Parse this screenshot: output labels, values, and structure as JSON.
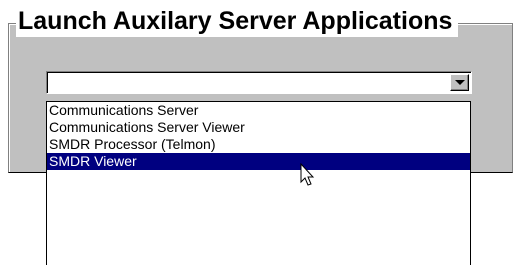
{
  "group": {
    "title": "Launch Auxilary Server Applications"
  },
  "combo": {
    "value": "",
    "button_icon": "dropdown-arrow-icon"
  },
  "dropdown": {
    "items": [
      {
        "label": "Communications Server",
        "selected": false
      },
      {
        "label": "Communications Server Viewer",
        "selected": false
      },
      {
        "label": "SMDR Processor (Telmon)",
        "selected": false
      },
      {
        "label": "SMDR Viewer",
        "selected": true
      }
    ]
  },
  "colors": {
    "dialog_background": "#c0c0c0",
    "selection_background": "#000080",
    "selection_text": "#ffffff"
  },
  "cursor": {
    "icon": "mouse-pointer-icon"
  }
}
